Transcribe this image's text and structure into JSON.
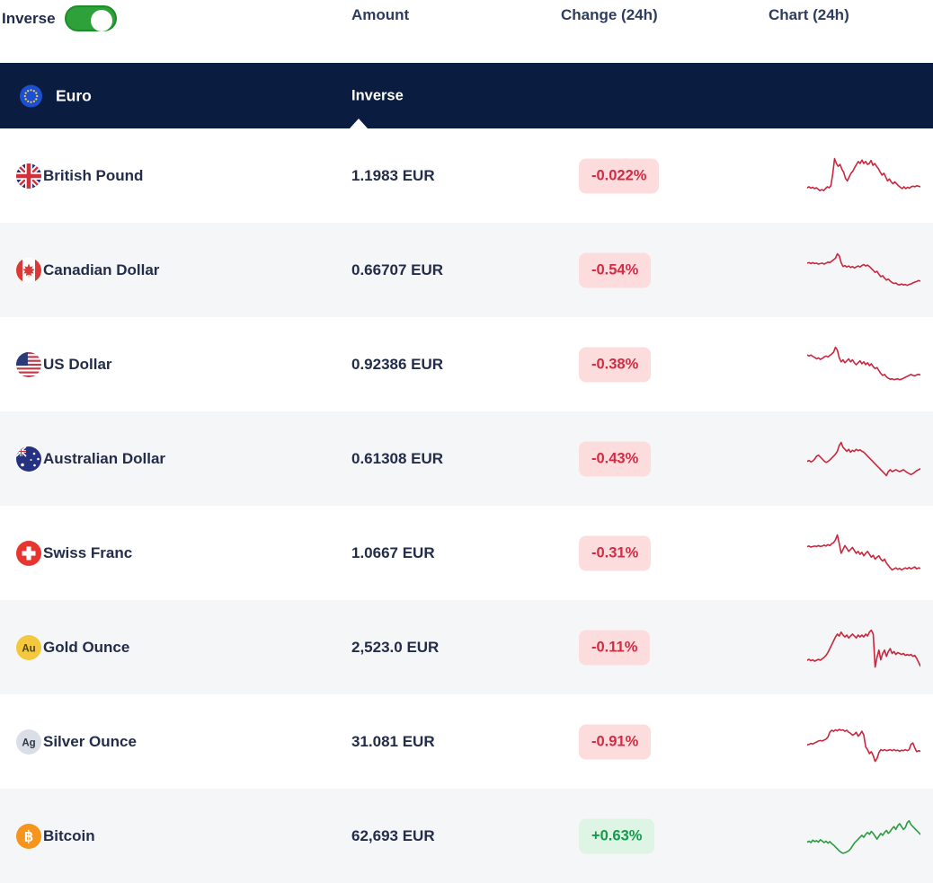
{
  "toolbar": {
    "inverse_label": "Inverse",
    "toggle_on": true
  },
  "columns": {
    "amount": "Amount",
    "change": "Change (24h)",
    "chart": "Chart (24h)"
  },
  "base": {
    "name": "Euro",
    "mode_label": "Inverse",
    "icon": "euro"
  },
  "colors": {
    "header_bg": "#0a1c40",
    "toggle_green": "#2fa13a",
    "toggle_border": "#1d8d29",
    "line_red": "#c9273d",
    "line_green": "#2a9d3f",
    "badge_neg_bg": "#fcdcdc",
    "badge_neg_text": "#d12c44",
    "badge_pos_bg": "#def4e5",
    "badge_pos_text": "#159a4c"
  },
  "rows": [
    {
      "name": "British Pound",
      "icon": "gb",
      "amount": "1.1983 EUR",
      "change": "-0.022%",
      "direction": "down",
      "spark": [
        74,
        72,
        75,
        73,
        76,
        74,
        77,
        80,
        78,
        80,
        76,
        72,
        74,
        70,
        45,
        14,
        24,
        30,
        26,
        36,
        42,
        55,
        60,
        52,
        44,
        40,
        33,
        26,
        20,
        24,
        17,
        24,
        20,
        26,
        24,
        18,
        28,
        24,
        30,
        35,
        42,
        48,
        44,
        52,
        60,
        56,
        62,
        66,
        62,
        66,
        70,
        73,
        76,
        72,
        76,
        73,
        75,
        72,
        71,
        72,
        70,
        71,
        72
      ]
    },
    {
      "name": "Canadian Dollar",
      "icon": "ca",
      "amount": "0.66707 EUR",
      "change": "-0.54%",
      "direction": "down",
      "spark": [
        35,
        34,
        36,
        34,
        36,
        35,
        37,
        36,
        35,
        37,
        35,
        33,
        34,
        31,
        28,
        25,
        16,
        20,
        34,
        42,
        40,
        43,
        41,
        44,
        42,
        45,
        43,
        41,
        43,
        40,
        38,
        41,
        39,
        42,
        46,
        50,
        54,
        52,
        58,
        63,
        61,
        66,
        70,
        68,
        72,
        75,
        77,
        76,
        79,
        80,
        78,
        80,
        79,
        81,
        79,
        78,
        76,
        74,
        73,
        71,
        72
      ]
    },
    {
      "name": "US Dollar",
      "icon": "us",
      "amount": "0.92386 EUR",
      "change": "-0.38%",
      "direction": "down",
      "spark": [
        30,
        32,
        30,
        33,
        35,
        38,
        36,
        39,
        37,
        34,
        32,
        34,
        31,
        28,
        24,
        14,
        20,
        36,
        44,
        40,
        46,
        42,
        38,
        44,
        40,
        46,
        50,
        46,
        42,
        48,
        44,
        50,
        46,
        52,
        48,
        54,
        58,
        56,
        62,
        68,
        72,
        70,
        75,
        78,
        80,
        79,
        81,
        80,
        79,
        81,
        80,
        78,
        76,
        74,
        72,
        70,
        72,
        73,
        71,
        70,
        71
      ]
    },
    {
      "name": "Australian Dollar",
      "icon": "au",
      "amount": "0.61308 EUR",
      "change": "-0.43%",
      "direction": "down",
      "spark": [
        55,
        53,
        56,
        54,
        50,
        44,
        42,
        46,
        50,
        54,
        57,
        55,
        52,
        48,
        44,
        40,
        34,
        22,
        16,
        26,
        30,
        34,
        30,
        36,
        32,
        34,
        30,
        33,
        31,
        34,
        36,
        40,
        44,
        48,
        52,
        56,
        60,
        64,
        68,
        72,
        76,
        80,
        84,
        76,
        72,
        76,
        74,
        72,
        74,
        76,
        74,
        72,
        75,
        78,
        80,
        82,
        80,
        77,
        74,
        72,
        70
      ]
    },
    {
      "name": "Swiss Franc",
      "icon": "ch",
      "amount": "1.0667 EUR",
      "change": "-0.31%",
      "direction": "down",
      "spark": [
        36,
        35,
        37,
        36,
        35,
        36,
        34,
        36,
        35,
        33,
        35,
        32,
        34,
        30,
        28,
        22,
        12,
        30,
        50,
        42,
        34,
        40,
        46,
        42,
        38,
        44,
        50,
        46,
        52,
        48,
        55,
        50,
        46,
        52,
        58,
        54,
        62,
        58,
        55,
        62,
        66,
        62,
        70,
        75,
        80,
        84,
        82,
        80,
        83,
        81,
        84,
        82,
        80,
        82,
        79,
        82,
        80,
        78,
        82,
        80,
        81
      ]
    },
    {
      "name": "Gold Ounce",
      "icon": "gold",
      "amount": "2,523.0 EUR",
      "change": "-0.11%",
      "direction": "down",
      "spark": [
        76,
        74,
        77,
        75,
        78,
        76,
        74,
        76,
        73,
        70,
        66,
        60,
        52,
        44,
        36,
        28,
        22,
        26,
        18,
        24,
        28,
        24,
        30,
        26,
        22,
        26,
        30,
        24,
        28,
        24,
        28,
        22,
        26,
        18,
        14,
        22,
        90,
        70,
        55,
        75,
        62,
        55,
        68,
        58,
        52,
        62,
        58,
        64,
        60,
        62,
        64,
        62,
        66,
        64,
        66,
        64,
        68,
        66,
        72,
        80,
        88
      ]
    },
    {
      "name": "Silver Ounce",
      "icon": "silver",
      "amount": "31.081 EUR",
      "change": "-0.91%",
      "direction": "down",
      "spark": [
        56,
        55,
        53,
        54,
        52,
        50,
        48,
        47,
        48,
        46,
        44,
        40,
        30,
        26,
        28,
        25,
        27,
        24,
        26,
        25,
        28,
        26,
        30,
        32,
        36,
        34,
        30,
        38,
        34,
        28,
        36,
        60,
        66,
        74,
        70,
        78,
        90,
        84,
        72,
        66,
        68,
        66,
        68,
        67,
        66,
        68,
        66,
        68,
        67,
        69,
        67,
        68,
        66,
        68,
        66,
        55,
        52,
        62,
        70,
        68,
        69
      ]
    },
    {
      "name": "Bitcoin",
      "icon": "btc",
      "amount": "62,693 EUR",
      "change": "+0.63%",
      "direction": "up",
      "spark": [
        62,
        60,
        63,
        58,
        61,
        59,
        62,
        57,
        60,
        63,
        60,
        64,
        61,
        65,
        68,
        72,
        76,
        80,
        83,
        85,
        84,
        82,
        80,
        76,
        70,
        64,
        60,
        56,
        52,
        48,
        52,
        46,
        42,
        46,
        40,
        44,
        50,
        56,
        50,
        44,
        48,
        42,
        38,
        44,
        40,
        34,
        30,
        36,
        28,
        24,
        30,
        36,
        32,
        22,
        18,
        26,
        30,
        34,
        38,
        42,
        46
      ]
    }
  ]
}
